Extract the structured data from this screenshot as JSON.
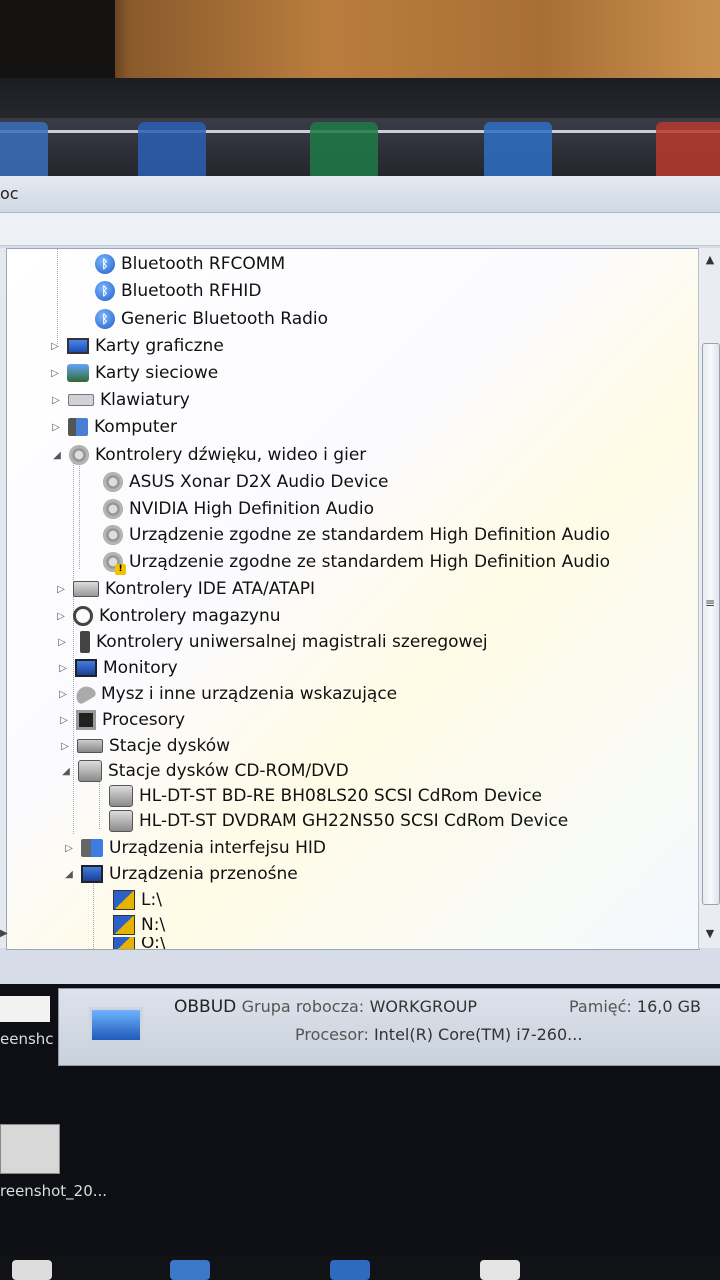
{
  "window": {
    "title_fragment": "oc"
  },
  "tree": [
    {
      "label": "Bluetooth RFCOMM",
      "icon": "bluetooth-icon"
    },
    {
      "label": "Bluetooth RFHID",
      "icon": "bluetooth-icon"
    },
    {
      "label": "Generic Bluetooth Radio",
      "icon": "bluetooth-icon"
    },
    {
      "label": "Karty graficzne",
      "icon": "display-adapter-icon"
    },
    {
      "label": "Karty sieciowe",
      "icon": "network-adapter-icon"
    },
    {
      "label": "Klawiatury",
      "icon": "keyboard-icon"
    },
    {
      "label": "Komputer",
      "icon": "computer-icon"
    },
    {
      "label": "Kontrolery dźwięku, wideo i gier",
      "icon": "sound-icon"
    },
    {
      "label": "ASUS Xonar D2X Audio Device",
      "icon": "sound-device-icon"
    },
    {
      "label": "NVIDIA High Definition Audio",
      "icon": "sound-device-icon"
    },
    {
      "label": "Urządzenie zgodne ze standardem High Definition Audio",
      "icon": "sound-device-icon"
    },
    {
      "label": "Urządzenie zgodne ze standardem High Definition Audio",
      "icon": "sound-device-warning-icon"
    },
    {
      "label": "Kontrolery IDE ATA/ATAPI",
      "icon": "ide-controller-icon"
    },
    {
      "label": "Kontrolery magazynu",
      "icon": "storage-controller-icon"
    },
    {
      "label": "Kontrolery uniwersalnej magistrali szeregowej",
      "icon": "usb-controller-icon"
    },
    {
      "label": "Monitory",
      "icon": "monitor-icon"
    },
    {
      "label": "Mysz i inne urządzenia wskazujące",
      "icon": "mouse-icon"
    },
    {
      "label": "Procesory",
      "icon": "processor-icon"
    },
    {
      "label": "Stacje dysków",
      "icon": "disk-drive-icon"
    },
    {
      "label": "Stacje dysków CD-ROM/DVD",
      "icon": "cdrom-icon"
    },
    {
      "label": "HL-DT-ST BD-RE  BH08LS20 SCSI CdRom Device",
      "icon": "cdrom-device-icon"
    },
    {
      "label": "HL-DT-ST DVDRAM GH22NS50 SCSI CdRom Device",
      "icon": "cdrom-device-icon"
    },
    {
      "label": "Urządzenia interfejsu HID",
      "icon": "hid-icon"
    },
    {
      "label": "Urządzenia przenośne",
      "icon": "portable-devices-icon"
    },
    {
      "label": "L:\\",
      "icon": "portable-drive-icon"
    },
    {
      "label": "N:\\",
      "icon": "portable-drive-icon"
    },
    {
      "label": "O:\\",
      "icon": "portable-drive-icon"
    }
  ],
  "sysinfo": {
    "name": "OBBUD",
    "workgroup_label": "Grupa robocza:",
    "workgroup": "WORKGROUP",
    "memory_label": "Pamięć:",
    "memory": "16,0 GB",
    "cpu_label": "Procesor:",
    "cpu": "Intel(R) Core(TM) i7-260..."
  },
  "desktop": {
    "label1": "eenshc",
    "label2": "reenshot_20..."
  }
}
